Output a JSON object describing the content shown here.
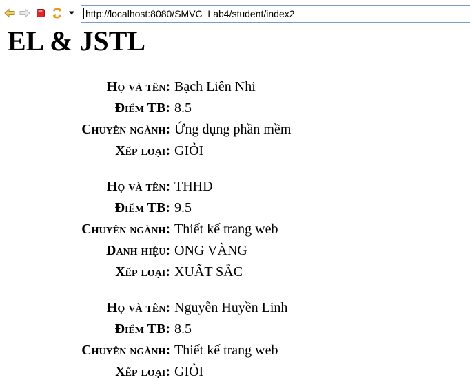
{
  "browser": {
    "url": "http://localhost:8080/SMVC_Lab4/student/index2"
  },
  "page": {
    "title": "EL & JSTL"
  },
  "students": [
    {
      "fields": [
        {
          "label": "Họ và tên:",
          "value": "Bạch Liên Nhi"
        },
        {
          "label": "Điểm TB:",
          "value": "8.5"
        },
        {
          "label": "Chuyên ngành:",
          "value": "Ứng dụng phần mềm"
        },
        {
          "label": "Xếp loại:",
          "value": "GIỎI"
        }
      ]
    },
    {
      "fields": [
        {
          "label": "Họ và tên:",
          "value": "THHD"
        },
        {
          "label": "Điểm TB:",
          "value": "9.5"
        },
        {
          "label": "Chuyên ngành:",
          "value": "Thiết kế trang web"
        },
        {
          "label": "Danh hiệu:",
          "value": "ONG VÀNG"
        },
        {
          "label": "Xếp loại:",
          "value": "XUẤT SẮC"
        }
      ]
    },
    {
      "fields": [
        {
          "label": "Họ và tên:",
          "value": "Nguyễn Huyền Linh"
        },
        {
          "label": "Điểm TB:",
          "value": "8.5"
        },
        {
          "label": "Chuyên ngành:",
          "value": "Thiết kế trang web"
        },
        {
          "label": "Xếp loại:",
          "value": "GIỎI"
        }
      ]
    }
  ]
}
